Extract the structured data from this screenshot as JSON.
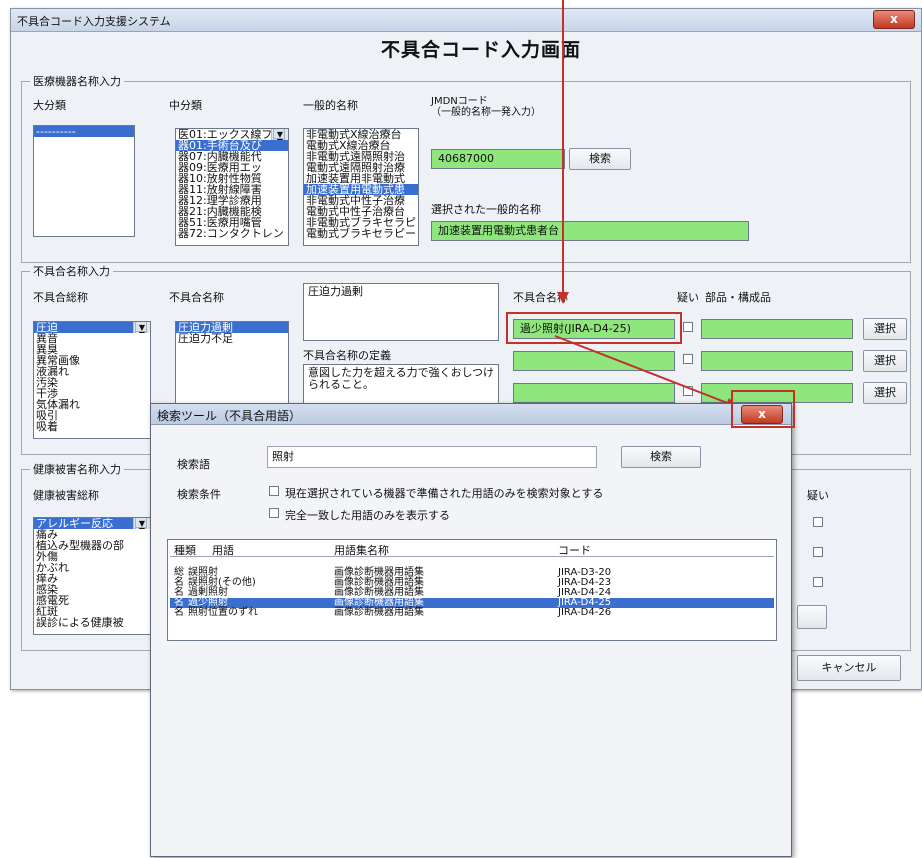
{
  "main_window": {
    "title": "不具合コード入力支援システム",
    "close": "x",
    "page_title": "不具合コード入力画面"
  },
  "device": {
    "legend": "医療機器名称入力",
    "major_label": "大分類",
    "major_items": [
      "----------"
    ],
    "middle_label": "中分類",
    "middle_items": [
      "医01:エックス線フィ",
      "器01:手術台及び",
      "器07:内臓機能代",
      "器09:医療用エッ",
      "器10:放射性物質",
      "器11:放射線障害",
      "器12:理学診療用",
      "器21:内臓機能検",
      "器51:医療用嘴管",
      "器72:コンタクトレン"
    ],
    "generic_label": "一般的名称",
    "generic_items": [
      "非電動式X線治療台",
      "電動式X線治療台",
      "非電動式遠隔照射治",
      "電動式遠隔照射治療",
      "加速装置用非電動式",
      "加速装置用電動式患",
      "非電動式中性子治療",
      "電動式中性子治療台",
      "非電動式ブラキセラピ",
      "電動式ブラキセラピーミ"
    ],
    "jmdn_label": "JMDNコード",
    "jmdn_sub": "（一般的名称一発入力）",
    "jmdn_code": "40687000",
    "search_button": "検索",
    "selected_label": "選択された一般的名称",
    "selected_value": "加速装置用電動式患者台"
  },
  "defect": {
    "legend": "不具合名称入力",
    "general_label": "不具合総称",
    "general_items": [
      "圧迫",
      "異音",
      "異臭",
      "異常画像",
      "液漏れ",
      "汚染",
      "干渉",
      "気体漏れ",
      "吸引",
      "吸着"
    ],
    "name_label": "不具合名称",
    "name_items": [
      "圧迫力過剰",
      "圧迫力不足"
    ],
    "selected_name": "圧迫力過剰",
    "definition_label": "不具合名称の定義",
    "definition_text": "意図した力を超える力で強くおしつけられること。",
    "code_label": "不具合名称",
    "suspect_label": "疑い",
    "parts_label": "部品・構成品",
    "code_value": "過少照射(JIRA-D4-25)",
    "select_button": "選択"
  },
  "health": {
    "legend": "健康被害名称入力",
    "general_label": "健康被害総称",
    "general_items": [
      "アレルギー反応",
      "痛み",
      "植込み型機器の部",
      "外傷",
      "かぶれ",
      "痒み",
      "感染",
      "感電死",
      "紅斑",
      "誤診による健康被"
    ],
    "suspect_label": "疑い",
    "cancel_button": "キャンセル"
  },
  "search_dialog": {
    "title": "検索ツール（不具合用語）",
    "close": "x",
    "term_label": "検索語",
    "term_value": "照射",
    "search_button": "検索",
    "cond_label": "検索条件",
    "cond1": "現在選択されている機器で準備された用語のみを検索対象とする",
    "cond2": "完全一致した用語のみを表示する",
    "columns": {
      "kind": "種類",
      "term": "用語",
      "set": "用語集名称",
      "code": "コード"
    },
    "rows": [
      {
        "kind": "総",
        "term": "誤照射",
        "set": "画像診断機器用語集",
        "code": "JIRA-D3-20"
      },
      {
        "kind": "名",
        "term": "誤照射(その他)",
        "set": "画像診断機器用語集",
        "code": "JIRA-D4-23"
      },
      {
        "kind": "名",
        "term": "過剰照射",
        "set": "画像診断機器用語集",
        "code": "JIRA-D4-24"
      },
      {
        "kind": "名",
        "term": "過少照射",
        "set": "画像診断機器用語集",
        "code": "JIRA-D4-25"
      },
      {
        "kind": "名",
        "term": "照射位置のずれ",
        "set": "画像診断機器用語集",
        "code": "JIRA-D4-26"
      }
    ],
    "selected_row": 3
  },
  "colors": {
    "accent_red": "#c4312b",
    "selection_blue": "#3a6fd0",
    "field_green": "#8fe67c"
  }
}
